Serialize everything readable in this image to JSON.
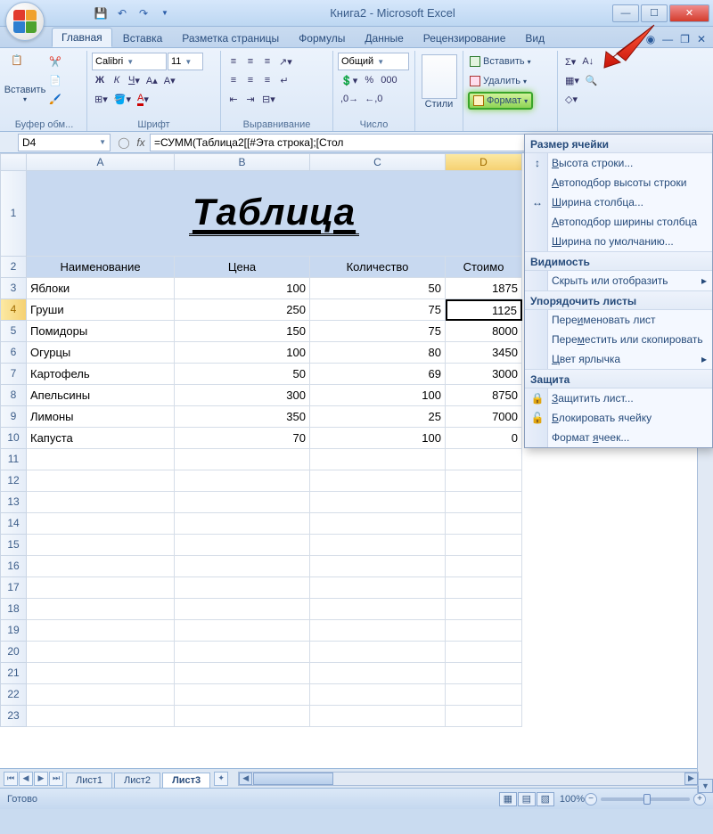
{
  "window": {
    "title": "Книга2 - Microsoft Excel"
  },
  "ribbon": {
    "tabs": [
      "Главная",
      "Вставка",
      "Разметка страницы",
      "Формулы",
      "Данные",
      "Рецензирование",
      "Вид"
    ],
    "active_tab": "Главная",
    "groups": {
      "clipboard": "Буфер обм...",
      "font": "Шрифт",
      "alignment": "Выравнивание",
      "number": "Число",
      "styles": "Стили",
      "cells": "",
      "editing": ""
    },
    "paste_label": "Вставить",
    "font_name": "Calibri",
    "font_size": "11",
    "number_format": "Общий",
    "styles_label": "Стили",
    "cells_items": {
      "insert": "Вставить",
      "delete": "Удалить",
      "format": "Формат"
    }
  },
  "formula_bar": {
    "name_box": "D4",
    "fx": "fx",
    "formula": "=СУММ(Таблица2[[#Эта строка];[Стол"
  },
  "worksheet": {
    "title": "Таблица",
    "columns": [
      "A",
      "B",
      "C",
      "D"
    ],
    "headers": [
      "Наименование",
      "Цена",
      "Количество",
      "Стоимо"
    ],
    "rows": [
      {
        "n": "3",
        "a": "Яблоки",
        "b": "100",
        "c": "50",
        "d": "1875"
      },
      {
        "n": "4",
        "a": "Груши",
        "b": "250",
        "c": "75",
        "d": "1125"
      },
      {
        "n": "5",
        "a": "Помидоры",
        "b": "150",
        "c": "75",
        "d": "8000"
      },
      {
        "n": "6",
        "a": "Огурцы",
        "b": "100",
        "c": "80",
        "d": "3450"
      },
      {
        "n": "7",
        "a": "Картофель",
        "b": "50",
        "c": "69",
        "d": "3000"
      },
      {
        "n": "8",
        "a": "Апельсины",
        "b": "300",
        "c": "100",
        "d": "8750"
      },
      {
        "n": "9",
        "a": "Лимоны",
        "b": "350",
        "c": "25",
        "d": "7000"
      },
      {
        "n": "10",
        "a": "Капуста",
        "b": "70",
        "c": "100",
        "d": "0"
      }
    ],
    "empty_rows": [
      "11",
      "12",
      "13",
      "14",
      "15",
      "16",
      "17",
      "18",
      "19",
      "20",
      "21",
      "22",
      "23"
    ],
    "active_cell": "D4"
  },
  "sheet_tabs": {
    "tabs": [
      "Лист1",
      "Лист2",
      "Лист3"
    ],
    "active": "Лист3"
  },
  "status": {
    "text": "Готово",
    "zoom": "100%"
  },
  "dropdown": {
    "sections": [
      {
        "title": "Размер ячейки",
        "items": [
          {
            "label": "Высота строки...",
            "u": 0,
            "icon": "↕"
          },
          {
            "label": "Автоподбор высоты строки",
            "u": 0
          },
          {
            "label": "Ширина столбца...",
            "u": 0,
            "icon": "↔"
          },
          {
            "label": "Автоподбор ширины столбца",
            "u": 0
          },
          {
            "label": "Ширина по умолчанию...",
            "u": 0
          }
        ]
      },
      {
        "title": "Видимость",
        "items": [
          {
            "label": "Скрыть или отобразить",
            "u": -1,
            "arrow": true
          }
        ]
      },
      {
        "title": "Упорядочить листы",
        "items": [
          {
            "label": "Переименовать лист",
            "u": 4
          },
          {
            "label": "Переместить или скопировать",
            "u": 4
          },
          {
            "label": "Цвет ярлычка",
            "u": 0,
            "arrow": true
          }
        ]
      },
      {
        "title": "Защита",
        "items": [
          {
            "label": "Защитить лист...",
            "u": 0,
            "icon": "🔒"
          },
          {
            "label": "Блокировать ячейку",
            "u": 0,
            "icon": "🔓"
          },
          {
            "label": "Формат ячеек...",
            "u": 7
          }
        ]
      }
    ]
  }
}
